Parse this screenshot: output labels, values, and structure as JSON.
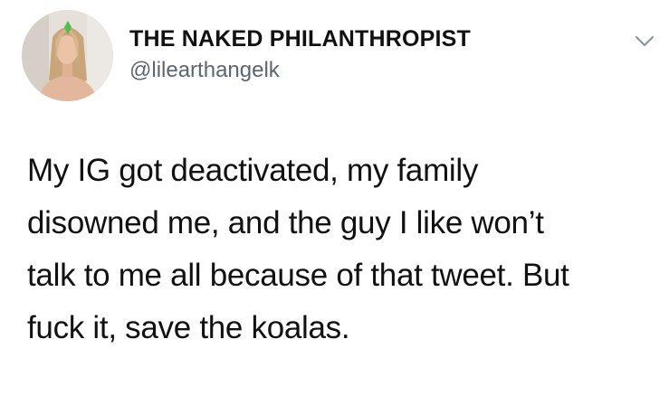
{
  "tweet": {
    "display_name": "THE NAKED PHILANTHROPIST",
    "handle": "@lilearthangelk",
    "avatar_icon": "profile-photo",
    "menu_icon": "chevron-down-icon",
    "text_lines": [
      "My IG got deactivated, my family",
      "disowned me, and the guy I like won’t",
      "talk to me all because of that tweet. But",
      "fuck it, save the koalas."
    ],
    "colors": {
      "name": "#111111",
      "handle": "#5b6670",
      "body": "#111111",
      "chevron": "#8a96a0",
      "avatar_badge": "#4cc04a"
    }
  }
}
